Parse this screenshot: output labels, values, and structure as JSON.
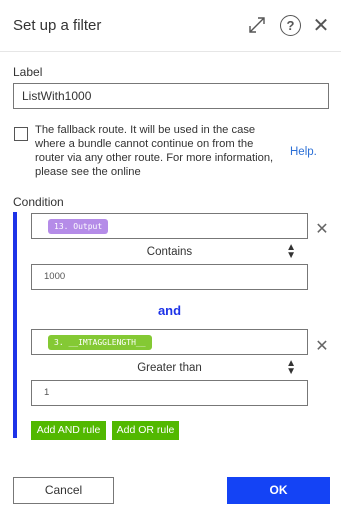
{
  "header": {
    "title": "Set up a filter",
    "icons": [
      "expand-icon",
      "help-icon",
      "close-icon"
    ]
  },
  "form": {
    "label_caption": "Label",
    "label_value": "ListWith1000",
    "fallback_text": "The fallback route. It will be used in the case where a bundle cannot continue on from the router via any other route. For more information, please see the online",
    "fallback_checked": false,
    "help_link": "Help.",
    "condition_caption": "Condition"
  },
  "conditions": [
    {
      "operand": "13. Output",
      "operand_color": "#b58ce8",
      "operator": "Contains",
      "value": "1000"
    },
    {
      "operand": "3. __IMTAGGLENGTH__",
      "operand_color": "#84c934",
      "operator": "Greater than",
      "value": "1"
    }
  ],
  "and_label": "and",
  "buttons": {
    "add_and": "Add AND rule",
    "add_or": "Add OR rule",
    "cancel": "Cancel",
    "ok": "OK"
  },
  "colors": {
    "accent": "#1d33e8",
    "ok_button": "#1443f5",
    "rule_button": "#52b800",
    "link": "#2b6fd6"
  }
}
